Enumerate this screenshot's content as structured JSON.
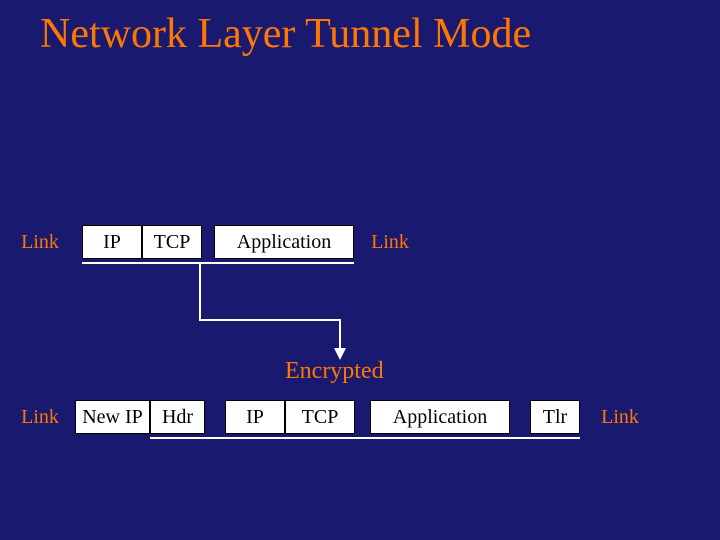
{
  "title": "Network Layer Tunnel Mode",
  "row1": {
    "link_left": "Link",
    "ip": "IP",
    "tcp": "TCP",
    "application": "Application",
    "link_right": "Link"
  },
  "encrypted_label": "Encrypted",
  "row2": {
    "link_left": "Link",
    "new_ip": "New IP",
    "hdr": "Hdr",
    "ip": "IP",
    "tcp": "TCP",
    "application": "Application",
    "tlr": "Tlr",
    "link_right": "Link"
  },
  "colors": {
    "background": "#191970",
    "accent": "#ff7700",
    "box_fill": "#ffffff",
    "line": "#ffffff"
  }
}
